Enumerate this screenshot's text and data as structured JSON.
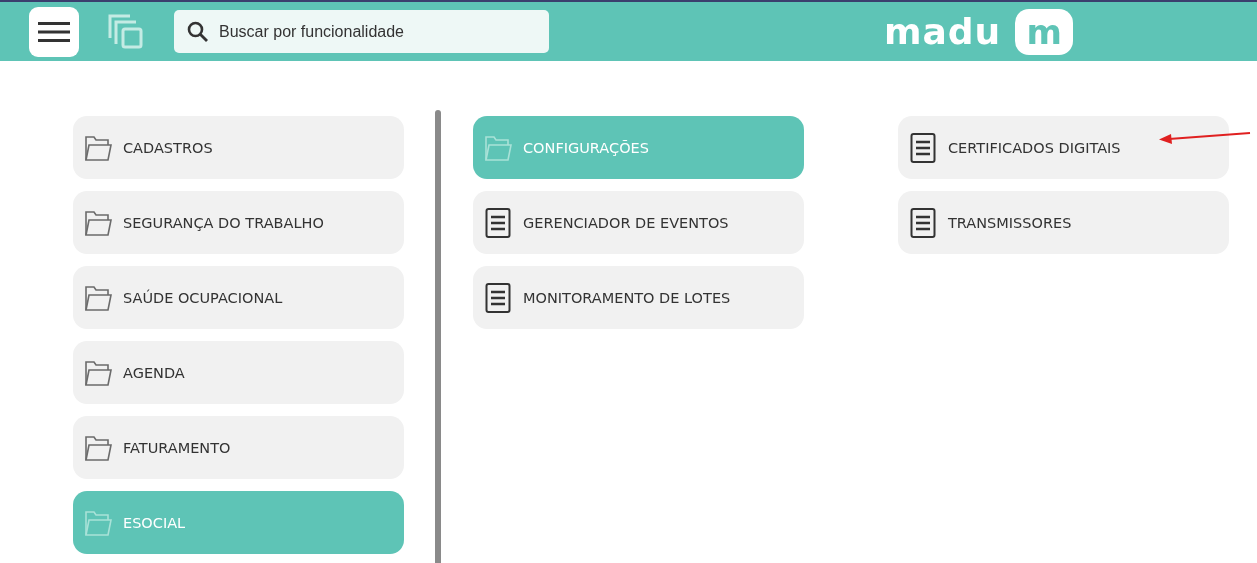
{
  "header": {
    "search": {
      "placeholder": "Buscar por funcionalidade"
    },
    "logo": {
      "word": "madu",
      "badge": "m"
    }
  },
  "columns": [
    {
      "items": [
        {
          "label": "CADASTROS",
          "kind": "folder",
          "selected": false
        },
        {
          "label": "SEGURANÇA DO TRABALHO",
          "kind": "folder",
          "selected": false
        },
        {
          "label": "SAÚDE OCUPACIONAL",
          "kind": "folder",
          "selected": false
        },
        {
          "label": "AGENDA",
          "kind": "folder",
          "selected": false
        },
        {
          "label": "FATURAMENTO",
          "kind": "folder",
          "selected": false
        },
        {
          "label": "ESOCIAL",
          "kind": "folder",
          "selected": true
        }
      ]
    },
    {
      "items": [
        {
          "label": "CONFIGURAÇÕES",
          "kind": "folder",
          "selected": true
        },
        {
          "label": "GERENCIADOR DE EVENTOS",
          "kind": "document",
          "selected": false
        },
        {
          "label": "MONITORAMENTO DE LOTES",
          "kind": "document",
          "selected": false
        }
      ]
    },
    {
      "items": [
        {
          "label": "CERTIFICADOS DIGITAIS",
          "kind": "document",
          "selected": false
        },
        {
          "label": "TRANSMISSORES",
          "kind": "document",
          "selected": false
        }
      ]
    }
  ]
}
